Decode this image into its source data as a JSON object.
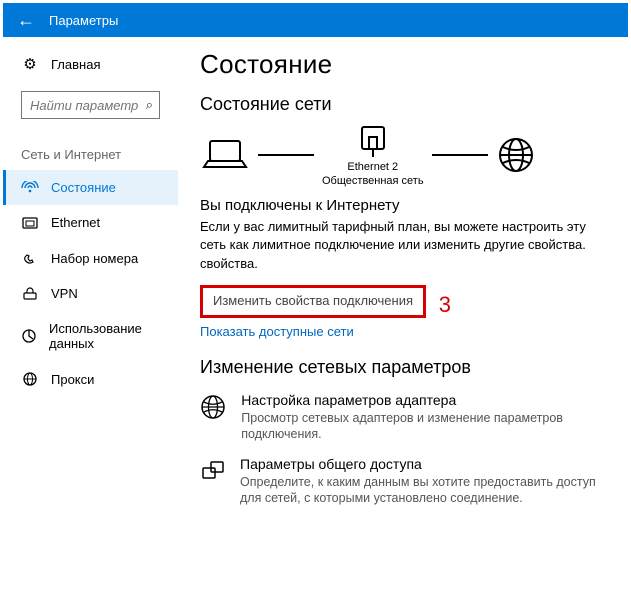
{
  "titlebar": {
    "title": "Параметры"
  },
  "sidebar": {
    "home": "Главная",
    "search_placeholder": "Найти параметр",
    "section": "Сеть и Интернет",
    "items": [
      {
        "label": "Состояние"
      },
      {
        "label": "Ethernet"
      },
      {
        "label": "Набор номера"
      },
      {
        "label": "VPN"
      },
      {
        "label": "Использование данных"
      },
      {
        "label": "Прокси"
      }
    ]
  },
  "main": {
    "h1": "Состояние",
    "h2a": "Состояние сети",
    "diagram": {
      "center_top": "Ethernet 2",
      "center_bottom": "Общественная сеть"
    },
    "connected": "Вы подключены к Интернету",
    "para": "Если у вас лимитный тарифный план, вы можете настроить эту сеть как лимитное подключение или изменить другие свойства.",
    "para2": "свойства.",
    "change_props": "Изменить свойства подключения",
    "annot_number": "3",
    "show_nets": "Показать доступные сети",
    "h2b": "Изменение сетевых параметров",
    "rows": [
      {
        "title": "Настройка параметров адаптера",
        "desc": "Просмотр сетевых адаптеров и изменение параметров подключения."
      },
      {
        "title": "Параметры общего доступа",
        "desc": "Определите, к каким данным вы хотите предоставить доступ для сетей, с которыми установлено соединение."
      }
    ]
  }
}
